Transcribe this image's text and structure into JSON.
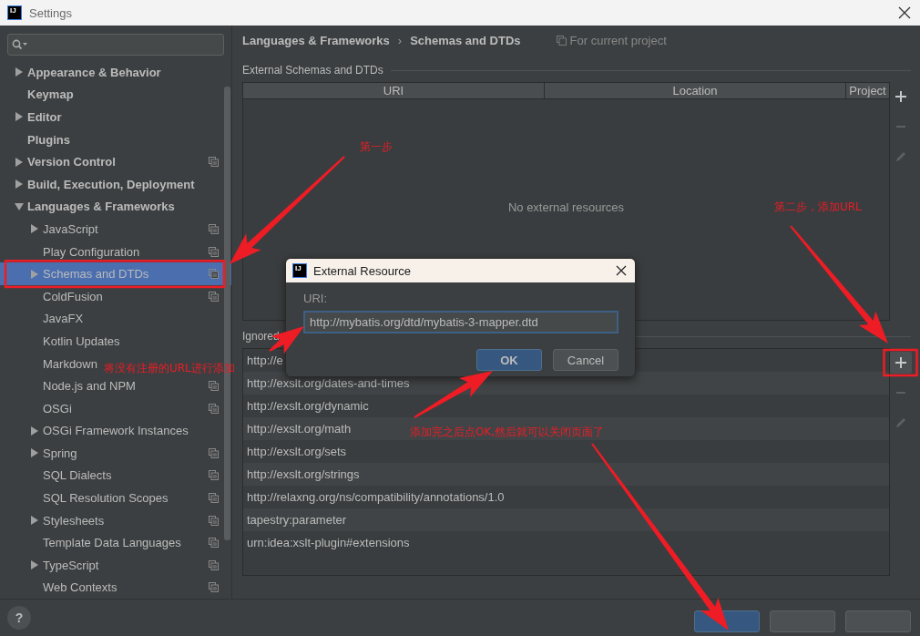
{
  "window": {
    "logo": "IJ",
    "title": "Settings"
  },
  "sidebar": {
    "items": [
      {
        "label": "Appearance & Behavior",
        "kind": "folder",
        "expanded": false,
        "selected": false,
        "project_icon": false
      },
      {
        "label": "Keymap",
        "kind": "page",
        "selected": false,
        "project_icon": false
      },
      {
        "label": "Editor",
        "kind": "folder",
        "expanded": false,
        "selected": false,
        "project_icon": false
      },
      {
        "label": "Plugins",
        "kind": "page",
        "selected": false,
        "project_icon": false
      },
      {
        "label": "Version Control",
        "kind": "folder",
        "expanded": false,
        "selected": false,
        "project_icon": true
      },
      {
        "label": "Build, Execution, Deployment",
        "kind": "folder",
        "expanded": false,
        "selected": false,
        "project_icon": false
      },
      {
        "label": "Languages & Frameworks",
        "kind": "folder",
        "expanded": true,
        "selected": false,
        "project_icon": false,
        "children": [
          {
            "label": "JavaScript",
            "kind": "folder",
            "expanded": false,
            "selected": false,
            "project_icon": true
          },
          {
            "label": "Play Configuration",
            "kind": "page",
            "selected": false,
            "project_icon": true
          },
          {
            "label": "Schemas and DTDs",
            "kind": "folder",
            "expanded": false,
            "selected": true,
            "project_icon": true
          },
          {
            "label": "ColdFusion",
            "kind": "page",
            "selected": false,
            "project_icon": true
          },
          {
            "label": "JavaFX",
            "kind": "page",
            "selected": false,
            "project_icon": false
          },
          {
            "label": "Kotlin Updates",
            "kind": "page",
            "selected": false,
            "project_icon": false
          },
          {
            "label": "Markdown",
            "kind": "page",
            "selected": false,
            "project_icon": false
          },
          {
            "label": "Node.js and NPM",
            "kind": "page",
            "selected": false,
            "project_icon": true
          },
          {
            "label": "OSGi",
            "kind": "page",
            "selected": false,
            "project_icon": true
          },
          {
            "label": "OSGi Framework Instances",
            "kind": "folder",
            "expanded": false,
            "selected": false,
            "project_icon": false
          },
          {
            "label": "Spring",
            "kind": "folder",
            "expanded": false,
            "selected": false,
            "project_icon": true
          },
          {
            "label": "SQL Dialects",
            "kind": "page",
            "selected": false,
            "project_icon": true
          },
          {
            "label": "SQL Resolution Scopes",
            "kind": "page",
            "selected": false,
            "project_icon": true
          },
          {
            "label": "Stylesheets",
            "kind": "folder",
            "expanded": false,
            "selected": false,
            "project_icon": true
          },
          {
            "label": "Template Data Languages",
            "kind": "page",
            "selected": false,
            "project_icon": true
          },
          {
            "label": "TypeScript",
            "kind": "folder",
            "expanded": false,
            "selected": false,
            "project_icon": true
          },
          {
            "label": "Web Contexts",
            "kind": "page",
            "selected": false,
            "project_icon": true
          }
        ]
      }
    ]
  },
  "breadcrumb": {
    "items": [
      "Languages & Frameworks",
      "Schemas and DTDs"
    ],
    "separator": "›",
    "scope": "For current project"
  },
  "external": {
    "title": "External Schemas and DTDs",
    "columns": [
      "URI",
      "Location",
      "Project"
    ],
    "empty_text": "No external resources",
    "toolbar": [
      {
        "kind": "add",
        "disabled": false,
        "highlighted": false
      },
      {
        "kind": "remove",
        "disabled": true,
        "highlighted": false
      },
      {
        "kind": "edit",
        "disabled": true,
        "highlighted": false
      }
    ]
  },
  "ignored": {
    "title": "Ignored",
    "rows": [
      "http://e",
      "http://exslt.org/dates-and-times",
      "http://exslt.org/dynamic",
      "http://exslt.org/math",
      "http://exslt.org/sets",
      "http://exslt.org/strings",
      "http://relaxng.org/ns/compatibility/annotations/1.0",
      "tapestry:parameter",
      "urn:idea:xslt-plugin#extensions"
    ],
    "toolbar": [
      {
        "kind": "add",
        "disabled": false,
        "highlighted": true
      },
      {
        "kind": "remove",
        "disabled": true,
        "highlighted": false
      },
      {
        "kind": "edit",
        "disabled": true,
        "highlighted": false
      }
    ]
  },
  "dialog": {
    "logo": "IJ",
    "title": "External Resource",
    "field_label": "URI:",
    "field_value": "http://mybatis.org/dtd/mybatis-3-mapper.dtd",
    "buttons": [
      {
        "label": "OK",
        "primary": true
      },
      {
        "label": "Cancel",
        "primary": false
      }
    ]
  },
  "footer": {
    "help": "?",
    "buttons": [
      {
        "primary": true
      },
      {
        "primary": false
      },
      {
        "primary": false
      }
    ]
  },
  "annotations": [
    {
      "text": "第一步"
    },
    {
      "text": "第二步，添加URL"
    },
    {
      "text": "将没有注册的URL进行添加"
    },
    {
      "text": "添加完之后点OK,然后就可以关闭页面了"
    }
  ]
}
